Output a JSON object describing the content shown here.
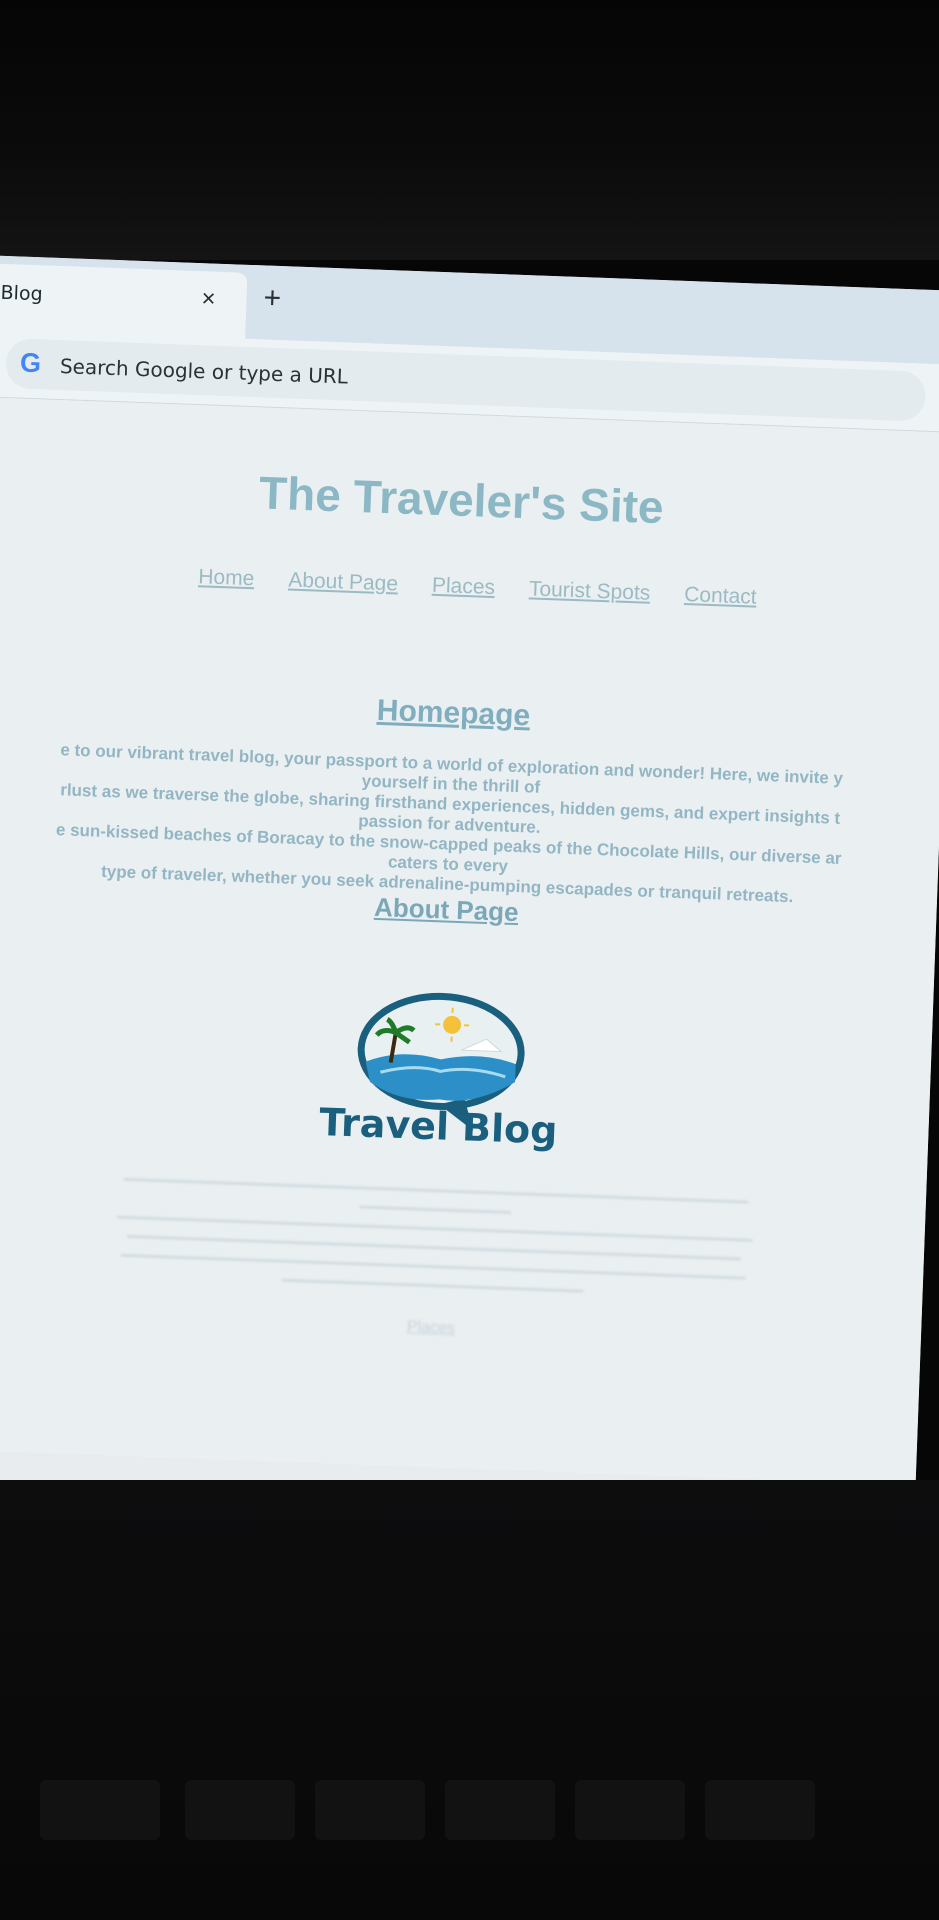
{
  "browser": {
    "tab_title": "Blog",
    "tab_close": "×",
    "new_tab": "+",
    "omnibox_placeholder": "Search Google or type a URL",
    "google_glyph": "G"
  },
  "page": {
    "site_title": "The Traveler's Site",
    "nav": [
      "Home",
      "About Page",
      "Places",
      "Tourist Spots",
      "Contact"
    ],
    "homepage_heading": "Homepage",
    "intro_lines": [
      "e to our vibrant travel blog, your passport to a world of exploration and wonder! Here, we invite y",
      "yourself in the thrill of",
      "rlust as we traverse the globe, sharing firsthand experiences, hidden gems, and expert insights t",
      "passion for adventure.",
      "e sun-kissed beaches of Boracay to the snow-capped peaks of the Chocolate Hills, our diverse ar",
      "caters to every",
      "type of traveler, whether you seek adrenaline-pumping escapades or tranquil retreats."
    ],
    "about_heading": "About Page",
    "logo_text": "Travel Blog",
    "places_link": "Places"
  },
  "colors": {
    "accent": "#8cb8c6",
    "logo_blue": "#1b5f7e",
    "page_bg": "#eaeff1"
  },
  "icons": [
    "google-icon",
    "close-icon",
    "plus-icon",
    "travel-blog-logo"
  ]
}
